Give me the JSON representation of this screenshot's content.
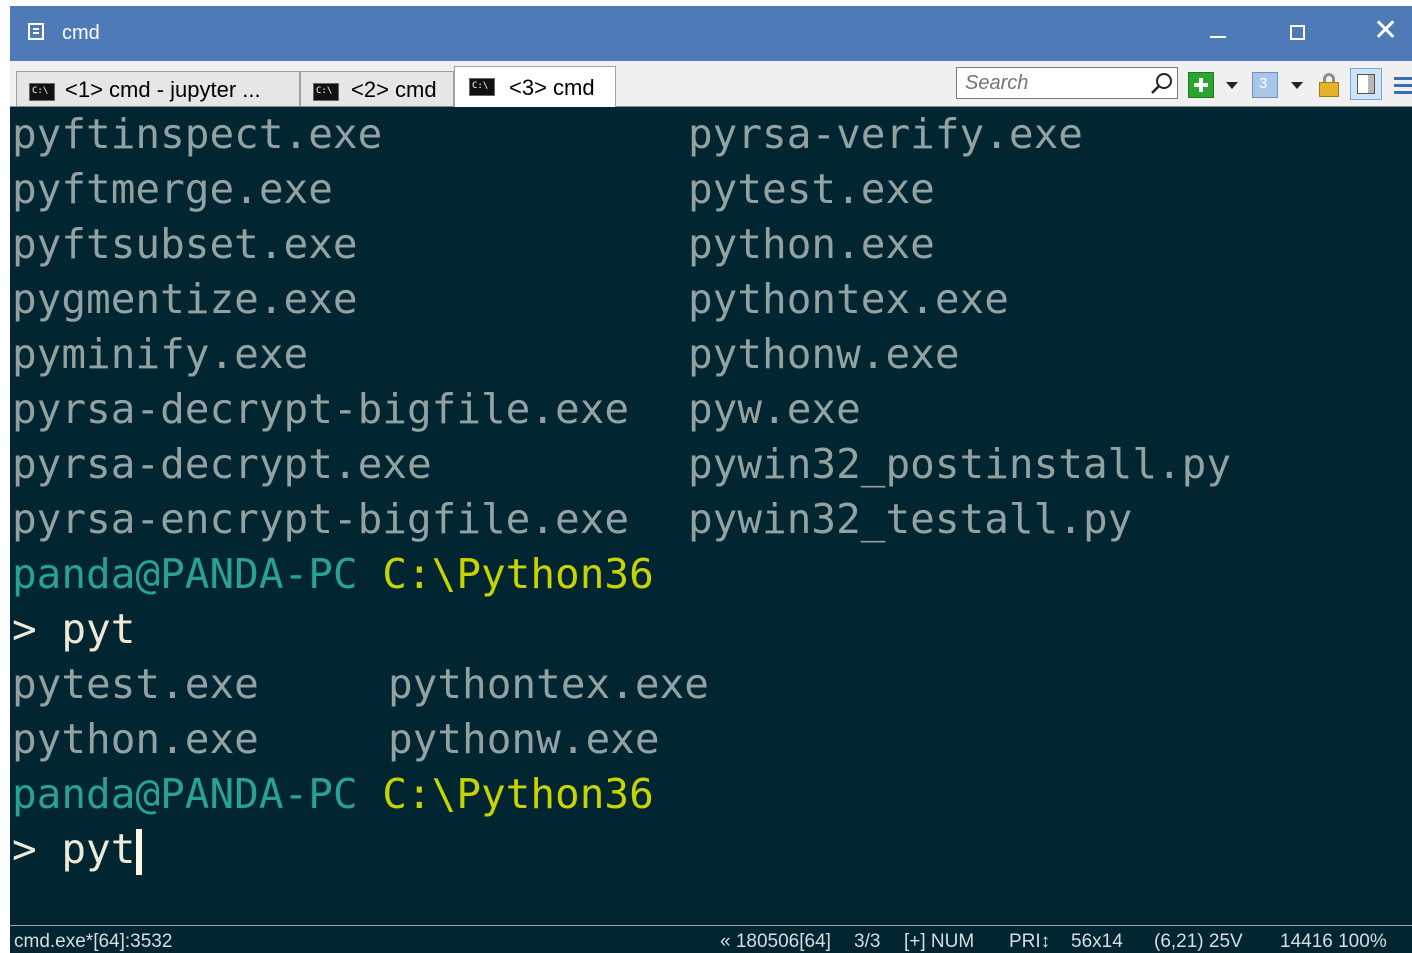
{
  "window": {
    "title": "cmd"
  },
  "tabs": [
    {
      "label": "<1> cmd - jupyter ...",
      "active": false
    },
    {
      "label": "<2> cmd",
      "active": false
    },
    {
      "label": "<3> cmd",
      "active": true
    }
  ],
  "search": {
    "placeholder": "Search"
  },
  "toolbar": {
    "icons": [
      "new-console-icon",
      "dropdown-icon",
      "panel-icon",
      "dropdown-icon",
      "lock-icon",
      "split-view-icon",
      "menu-icon"
    ],
    "panel_label": "3"
  },
  "console": {
    "listing1": [
      [
        "pyftinspect.exe",
        "pyrsa-verify.exe"
      ],
      [
        "pyftmerge.exe",
        "pytest.exe"
      ],
      [
        "pyftsubset.exe",
        "python.exe"
      ],
      [
        "pygmentize.exe",
        "pythontex.exe"
      ],
      [
        "pyminify.exe",
        "pythonw.exe"
      ],
      [
        "pyrsa-decrypt-bigfile.exe",
        "pyw.exe"
      ],
      [
        "pyrsa-decrypt.exe",
        "pywin32_postinstall.py"
      ],
      [
        "pyrsa-encrypt-bigfile.exe",
        "pywin32_testall.py"
      ]
    ],
    "prompt_user": "panda@PANDA-PC",
    "prompt_path": "C:\\Python36",
    "prompt_symbol": ">",
    "typed_1": "pyt",
    "listing2": [
      [
        "pytest.exe",
        "pythontex.exe"
      ],
      [
        "python.exe",
        "pythonw.exe"
      ]
    ],
    "typed_2": "pyt"
  },
  "statusbar": {
    "process": "cmd.exe*[64]:3532",
    "build": "« 180506[64]",
    "tab_index": "3/3",
    "mode": "[+] NUM",
    "priority": "PRI↕",
    "size": "56x14",
    "cursor_pos": "(6,21) 25V",
    "pid_zoom": "14416 100%"
  },
  "colors": {
    "titlebar": "#4e7ab8",
    "console_bg": "#012631",
    "text": "#93a1a1",
    "prompt_user": "#2aa198",
    "prompt_path": "#c7d400"
  }
}
